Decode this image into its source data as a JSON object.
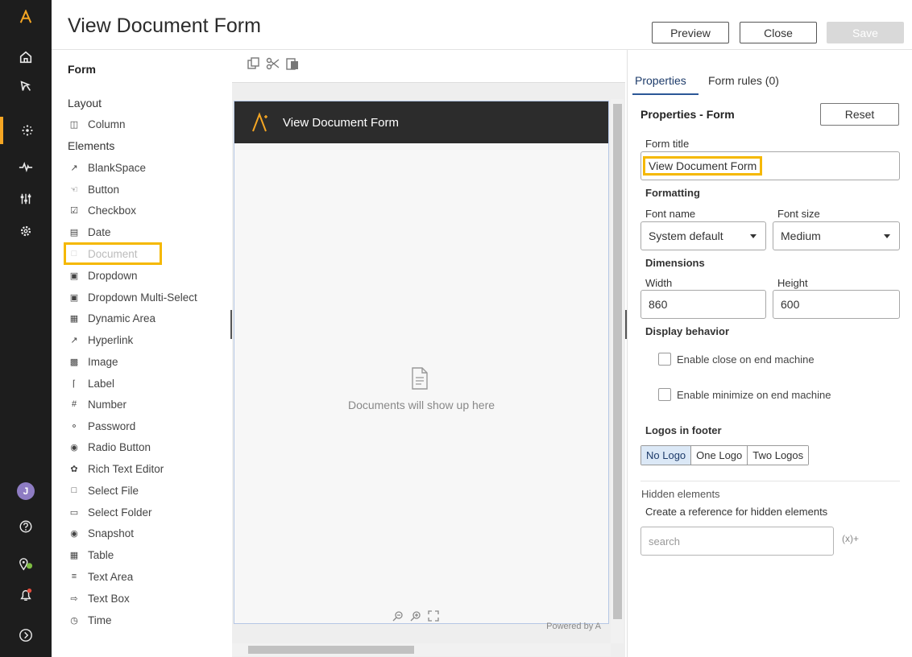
{
  "header": {
    "title": "View Document Form",
    "preview_label": "Preview",
    "close_label": "Close",
    "save_label": "Save"
  },
  "rail": {
    "icons": [
      "logo-icon",
      "home-icon",
      "explore-icon",
      "automation-icon",
      "activity-icon",
      "manage-icon",
      "settings-icon"
    ],
    "avatar_initial": "J",
    "bottom_icons": [
      "help-icon",
      "location-icon",
      "notifications-icon",
      "expand-icon"
    ]
  },
  "form_panel": {
    "heading": "Form",
    "layout_label": "Layout",
    "layout_items": [
      {
        "label": "Column",
        "icon": "column-icon"
      }
    ],
    "elements_label": "Elements",
    "elements": [
      {
        "label": "BlankSpace",
        "icon": "blankspace-icon"
      },
      {
        "label": "Button",
        "icon": "button-icon"
      },
      {
        "label": "Checkbox",
        "icon": "checkbox-icon"
      },
      {
        "label": "Date",
        "icon": "date-icon"
      },
      {
        "label": "Document",
        "icon": "document-icon"
      },
      {
        "label": "Dropdown",
        "icon": "dropdown-icon"
      },
      {
        "label": "Dropdown Multi-Select",
        "icon": "dropdown-multi-icon"
      },
      {
        "label": "Dynamic Area",
        "icon": "dynamic-area-icon"
      },
      {
        "label": "Hyperlink",
        "icon": "hyperlink-icon"
      },
      {
        "label": "Image",
        "icon": "image-icon"
      },
      {
        "label": "Label",
        "icon": "label-icon"
      },
      {
        "label": "Number",
        "icon": "number-icon"
      },
      {
        "label": "Password",
        "icon": "password-icon"
      },
      {
        "label": "Radio Button",
        "icon": "radio-icon"
      },
      {
        "label": "Rich Text Editor",
        "icon": "rich-text-icon"
      },
      {
        "label": "Select File",
        "icon": "select-file-icon"
      },
      {
        "label": "Select Folder",
        "icon": "select-folder-icon"
      },
      {
        "label": "Snapshot",
        "icon": "snapshot-icon"
      },
      {
        "label": "Table",
        "icon": "table-icon"
      },
      {
        "label": "Text Area",
        "icon": "text-area-icon"
      },
      {
        "label": "Text Box",
        "icon": "text-box-icon"
      },
      {
        "label": "Time",
        "icon": "time-icon"
      }
    ]
  },
  "canvas": {
    "toolbar_icons": [
      "copy-icon",
      "cut-icon",
      "paste-icon"
    ],
    "preview_title": "View Document Form",
    "empty_message": "Documents will show up here",
    "powered_by": "Powered by A",
    "zoom_icons": [
      "zoom-out-icon",
      "zoom-in-icon",
      "fit-screen-icon"
    ]
  },
  "properties": {
    "tabs": [
      {
        "label": "Properties",
        "active": true
      },
      {
        "label": "Form rules (0)",
        "active": false
      }
    ],
    "title": "Properties - Form",
    "reset_label": "Reset",
    "form_title_label": "Form title",
    "form_title_value": "View Document Form",
    "formatting_label": "Formatting",
    "font_name_label": "Font name",
    "font_name_value": "System default",
    "font_size_label": "Font size",
    "font_size_value": "Medium",
    "dimensions_label": "Dimensions",
    "width_label": "Width",
    "width_value": "860",
    "height_label": "Height",
    "height_value": "600",
    "display_behavior_label": "Display behavior",
    "enable_close_label": "Enable close on end machine",
    "enable_close_checked": false,
    "enable_minimize_label": "Enable minimize on end machine",
    "enable_minimize_checked": false,
    "logos_label": "Logos in footer",
    "logo_options": [
      "No Logo",
      "One Logo",
      "Two Logos"
    ],
    "logo_selected": "No Logo",
    "hidden_label": "Hidden elements",
    "hidden_desc": "Create a reference for hidden elements",
    "search_placeholder": "search",
    "var_icon_text": "(x)+"
  },
  "colors": {
    "rail_bg": "#1d1d1d",
    "accent": "#f5a623",
    "highlight": "#f5b800",
    "preview_header_bg": "#2c2c2c",
    "tab_active": "#2b5797"
  }
}
